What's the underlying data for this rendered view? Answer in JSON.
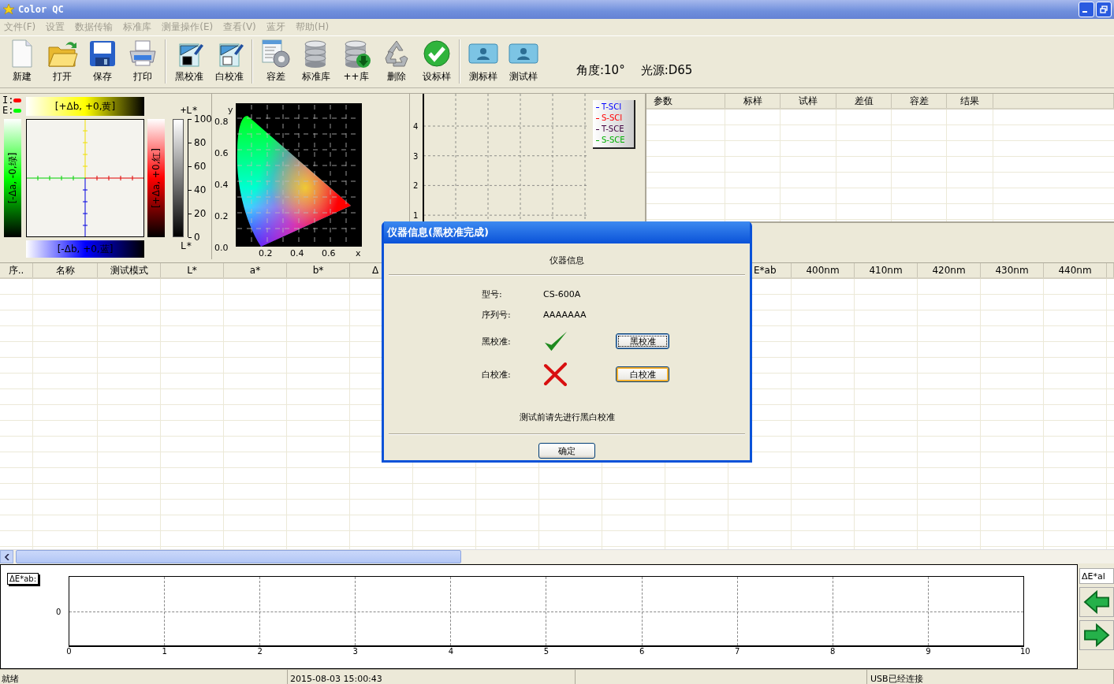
{
  "window": {
    "title": "Color QC"
  },
  "menu": [
    {
      "label": "文件(F)",
      "disabled": true
    },
    {
      "label": "设置",
      "disabled": true
    },
    {
      "label": "数据传输",
      "disabled": true
    },
    {
      "label": "标准库",
      "disabled": true
    },
    {
      "label": "测量操作(E)",
      "disabled": true
    },
    {
      "label": "查看(V)",
      "disabled": true
    },
    {
      "label": "蓝牙",
      "disabled": true
    },
    {
      "label": "帮助(H)",
      "disabled": true
    }
  ],
  "toolbar": [
    {
      "items": [
        {
          "label": "新建",
          "kind": "document"
        },
        {
          "label": "打开",
          "kind": "folder"
        },
        {
          "label": "保存",
          "kind": "floppy"
        },
        {
          "label": "打印",
          "kind": "printer"
        }
      ]
    },
    {
      "items": [
        {
          "label": "黑校准",
          "kind": "ruler-black"
        },
        {
          "label": "白校准",
          "kind": "ruler-white"
        }
      ]
    },
    {
      "items": [
        {
          "label": "容差",
          "kind": "gear-doc"
        },
        {
          "label": "标准库",
          "kind": "database"
        },
        {
          "label": "++库",
          "kind": "database-add"
        },
        {
          "label": "删除",
          "kind": "recycle"
        },
        {
          "label": "设标样",
          "kind": "check"
        }
      ]
    },
    {
      "items": [
        {
          "label": "测标样",
          "kind": "person"
        },
        {
          "label": "测试样",
          "kind": "person"
        }
      ]
    }
  ],
  "angle": "角度:10°",
  "illuminant": "光源:D65",
  "lab_panel": {
    "legend": [
      {
        "label": "I:",
        "color": "#ff0000"
      },
      {
        "label": "E:",
        "color": "#00ff00"
      }
    ],
    "top_label": "[+Δb, +0,黄]",
    "bottom_label": "[-Δb, +0,蓝]",
    "left_label": "[-Δa, -0,绿]",
    "right_label": "[+Δa, +0,红]",
    "lightness_top": "+L*",
    "lightness_bottom": "L*",
    "lightness_ticks": [
      "100",
      "80",
      "60",
      "40",
      "20",
      "0"
    ]
  },
  "chromaticity": {
    "y_axis": "y",
    "x_axis": "x",
    "y_ticks": [
      "0.8",
      "0.6",
      "0.4",
      "0.2",
      "0.0"
    ],
    "x_ticks": [
      "0.2",
      "0.4",
      "0.6"
    ]
  },
  "spectrum": {
    "y_ticks": [
      "4",
      "3",
      "2",
      "1"
    ],
    "legend": [
      {
        "label": "T-SCI",
        "color": "#0000ff"
      },
      {
        "label": "S-SCI",
        "color": "#ff0000"
      },
      {
        "label": "T-SCE",
        "color": "#400040"
      },
      {
        "label": "S-SCE",
        "color": "#00b000"
      }
    ]
  },
  "params_table": {
    "columns": [
      "参数",
      "标样",
      "试样",
      "差值",
      "容差",
      "结果"
    ]
  },
  "data_table": {
    "columns_left": [
      "序..",
      "名称",
      "测试模式",
      "L*",
      "a*",
      "b*",
      "Δ"
    ],
    "columns_right": [
      "E*ab",
      "400nm",
      "410nm",
      "420nm",
      "430nm",
      "440nm"
    ]
  },
  "bottom_chart": {
    "label": "ΔE*ab:",
    "y_ticks": [
      "0"
    ],
    "x_ticks": [
      "0",
      "1",
      "2",
      "3",
      "4",
      "5",
      "6",
      "7",
      "8",
      "9",
      "10"
    ],
    "side_button": "ΔE*al"
  },
  "status_bar": {
    "state": "就绪",
    "datetime": "2015-08-03 15:00:43",
    "connection": "USB已经连接"
  },
  "dialog": {
    "title": "仪器信息(黑校准完成)",
    "heading": "仪器信息",
    "fields": [
      {
        "label": "型号:",
        "value": "CS-600A"
      },
      {
        "label": "序列号:",
        "value": "AAAAAAA"
      }
    ],
    "calibrations": [
      {
        "label": "黑校准:",
        "done": true,
        "button": "黑校准",
        "focused": true
      },
      {
        "label": "白校准:",
        "done": false,
        "button": "白校准",
        "focused": false
      }
    ],
    "note": "测试前请先进行黑白校准",
    "ok": "确定"
  }
}
